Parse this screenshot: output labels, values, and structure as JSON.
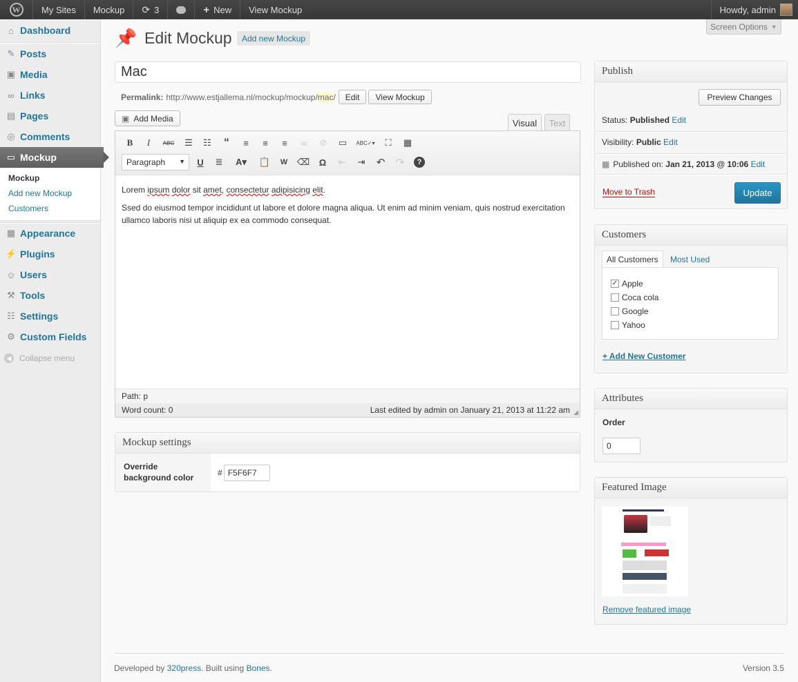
{
  "adminbar": {
    "wp_logo": "W",
    "my_sites": "My Sites",
    "site": "Mockup",
    "updates_count": "3",
    "new": "New",
    "view": "View Mockup",
    "howdy": "Howdy, admin"
  },
  "menu": {
    "dashboard": "Dashboard",
    "posts": "Posts",
    "media": "Media",
    "links": "Links",
    "pages": "Pages",
    "comments": "Comments",
    "mockup": "Mockup",
    "sub_mockup": "Mockup",
    "sub_add": "Add new Mockup",
    "sub_customers": "Customers",
    "appearance": "Appearance",
    "plugins": "Plugins",
    "users": "Users",
    "tools": "Tools",
    "settings": "Settings",
    "custom_fields": "Custom Fields",
    "collapse": "Collapse menu"
  },
  "header": {
    "screen_options": "Screen Options",
    "title": "Edit Mockup",
    "add_new": "Add new Mockup"
  },
  "post": {
    "title": "Mac",
    "permalink_label": "Permalink:",
    "permalink_base": "http://www.estjallema.nl/mockup/mockup/",
    "permalink_slug": "mac",
    "permalink_end": "/",
    "edit": "Edit",
    "view": "View Mockup"
  },
  "editor": {
    "add_media": "Add Media",
    "tab_visual": "Visual",
    "tab_text": "Text",
    "format": "Paragraph",
    "para1_a": "Lorem",
    "para1_b": "ipsum",
    "para1_c": "dolor",
    "para1_d": "sit",
    "para1_e": "amet",
    "para1_f": ", ",
    "para1_g": "consectetur",
    "para1_h": "adipisicing",
    "para1_i": "elit",
    "para1_j": ".",
    "para2": "Ssed do eiusmod tempor incididunt ut labore et dolore magna aliqua. Ut enim ad minim veniam, quis nostrud exercitation ullamco laboris nisi ut aliquip ex ea commodo consequat.",
    "path": "Path: p",
    "word_count": "Word count: 0",
    "last_edited": "Last edited by admin on January 21, 2013 at 11:22 am"
  },
  "mockup_settings": {
    "title": "Mockup settings",
    "label": "Override background color",
    "hash": "#",
    "value": "F5F6F7"
  },
  "publish": {
    "title": "Publish",
    "preview": "Preview Changes",
    "status_label": "Status:",
    "status": "Published",
    "visibility_label": "Visibility:",
    "visibility": "Public",
    "published_label": "Published on:",
    "published": "Jan 21, 2013 @ 10:06",
    "edit": "Edit",
    "trash": "Move to Trash",
    "update": "Update"
  },
  "customers": {
    "title": "Customers",
    "tab_all": "All Customers",
    "tab_most": "Most Used",
    "items": [
      {
        "label": "Apple",
        "checked": true
      },
      {
        "label": "Coca cola",
        "checked": false
      },
      {
        "label": "Google",
        "checked": false
      },
      {
        "label": "Yahoo",
        "checked": false
      }
    ],
    "add_new": "+ Add New Customer"
  },
  "attributes": {
    "title": "Attributes",
    "order_label": "Order",
    "order": "0"
  },
  "featured": {
    "title": "Featured Image",
    "remove": "Remove featured image"
  },
  "footer": {
    "dev": "Developed by ",
    "by_link": "320press",
    "built": ". Built using ",
    "bones": "Bones",
    "dot": ".",
    "version": "Version 3.5"
  },
  "colors": {
    "accent": "#21759b",
    "update_btn": "#2a95c5",
    "trash": "#bc0b0b"
  }
}
